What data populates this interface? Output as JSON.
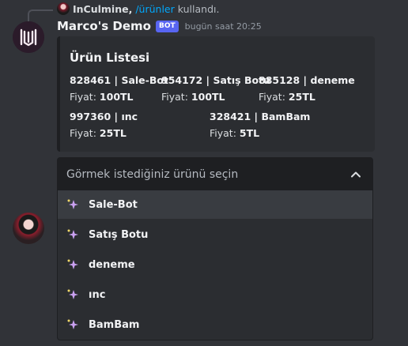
{
  "reply": {
    "username": "InCulmine,",
    "command": "/ürünler",
    "suffix": "kullandı."
  },
  "message": {
    "author": "Marco's Demo",
    "bot_tag": "BOT",
    "timestamp": "bugün saat 20:25"
  },
  "embed": {
    "title": "Ürün Listesi",
    "fields": [
      {
        "name": "828461 | Sale-Bot",
        "price_label": "Fiyat:",
        "price": "100TL"
      },
      {
        "name": "954172 | Satış Botu",
        "price_label": "Fiyat:",
        "price": "100TL"
      },
      {
        "name": "885128 | deneme",
        "price_label": "Fiyat:",
        "price": "25TL"
      },
      {
        "name": "997360 | ınc",
        "price_label": "Fiyat:",
        "price": "25TL"
      },
      {
        "name": "328421 | BamBam",
        "price_label": "Fiyat:",
        "price": "5TL"
      }
    ]
  },
  "select": {
    "placeholder": "Görmek istediğiniz ürünü seçin",
    "icon": "chevron-up-icon",
    "options": [
      {
        "label": "Sale-Bot",
        "icon": "sparkle-icon"
      },
      {
        "label": "Satış Botu",
        "icon": "sparkle-icon"
      },
      {
        "label": "deneme",
        "icon": "sparkle-icon"
      },
      {
        "label": "ınc",
        "icon": "sparkle-icon"
      },
      {
        "label": "BamBam",
        "icon": "sparkle-icon"
      }
    ]
  },
  "colors": {
    "background": "#313338",
    "embed": "#2b2d31",
    "accent": "#5865f2",
    "link": "#00a8fc"
  }
}
